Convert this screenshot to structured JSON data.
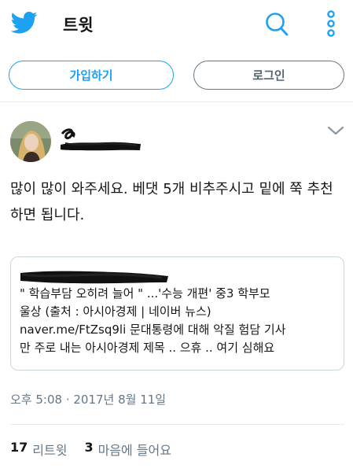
{
  "header": {
    "title": "트윗",
    "logo_icon": "twitter-bird-icon",
    "search_icon": "search-icon",
    "more_icon": "more-vertical-icon",
    "accent_color": "#1da1f2"
  },
  "auth": {
    "signup_label": "가입하기",
    "login_label": "로그인"
  },
  "tweet": {
    "text": "많이 많이 와주세요. 베댓 5개 비추주시고 밑에 쭉 추천하면 됩니다.",
    "caret_icon": "chevron-down-icon",
    "card": {
      "line1": "\" 학습부담 오히려 늘어 \" ...'수능 개편' 중3 학부모",
      "line2": "울상 (출처 : 아시아경제 | 네이버 뉴스)",
      "line3": "naver.me/FtZsq9li 문대통령에 대해 악질 험담 기사",
      "line4": "만 주로 내는 아시아경제 제목 .. 으휴 .. 여기 심해요"
    },
    "timestamp": "오후 5:08 · 2017년 8월 11일",
    "stats": {
      "retweets_count": "17",
      "retweets_label": "리트윗",
      "likes_count": "3",
      "likes_label": "마음에 들어요"
    }
  }
}
